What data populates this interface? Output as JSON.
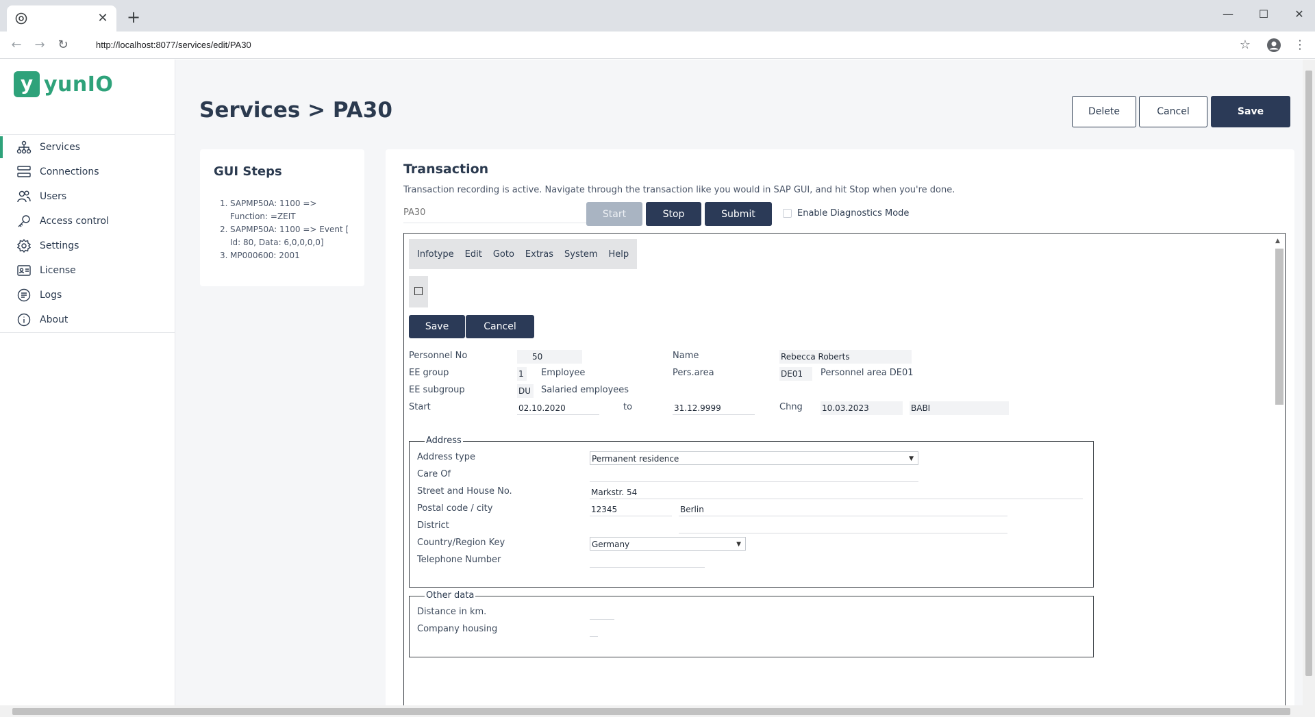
{
  "browser": {
    "url": "http://localhost:8077/services/edit/PA30",
    "tab_close": "✕",
    "new_tab": "+"
  },
  "logo": {
    "mark": "y",
    "text": "yunIO"
  },
  "sidebar": {
    "items": [
      {
        "label": "Services",
        "icon": "sitemap-icon",
        "active": true
      },
      {
        "label": "Connections",
        "icon": "connections-icon",
        "active": false
      },
      {
        "label": "Users",
        "icon": "users-icon",
        "active": false
      },
      {
        "label": "Access control",
        "icon": "key-icon",
        "active": false
      },
      {
        "label": "Settings",
        "icon": "gear-icon",
        "active": false
      },
      {
        "label": "License",
        "icon": "license-icon",
        "active": false
      },
      {
        "label": "Logs",
        "icon": "logs-icon",
        "active": false
      },
      {
        "label": "About",
        "icon": "info-icon",
        "active": false
      }
    ]
  },
  "header": {
    "title": "Services > PA30",
    "delete_label": "Delete",
    "cancel_label": "Cancel",
    "save_label": "Save"
  },
  "gui_steps": {
    "title": "GUI Steps",
    "steps": [
      {
        "num": "1.",
        "text": "SAPMP50A: 1100 => Function: =ZEIT"
      },
      {
        "num": "2.",
        "text": "SAPMP50A: 1100 => Event [ Id: 80, Data: 6,0,0,0,0]"
      },
      {
        "num": "3.",
        "text": "MP000600: 2001"
      }
    ]
  },
  "transaction": {
    "title": "Transaction",
    "description": "Transaction recording is active. Navigate through the transaction like you would in SAP GUI, and hit Stop when you're done.",
    "input_placeholder": "PA30",
    "start_label": "Start",
    "stop_label": "Stop",
    "submit_label": "Submit",
    "diagnostics_label": "Enable Diagnostics Mode"
  },
  "sap": {
    "menu": [
      "Infotype",
      "Edit",
      "Goto",
      "Extras",
      "System",
      "Help"
    ],
    "save_label": "Save",
    "cancel_label": "Cancel",
    "header": {
      "personnel_no_label": "Personnel No",
      "personnel_no": "50",
      "name_label": "Name",
      "name": "Rebecca Roberts",
      "ee_group_label": "EE group",
      "ee_group": "1",
      "ee_group_text": "Employee",
      "pers_area_label": "Pers.area",
      "pers_area": "DE01",
      "pers_area_text": "Personnel area DE01",
      "ee_subgroup_label": "EE subgroup",
      "ee_subgroup": "DU",
      "ee_subgroup_text": "Salaried employees",
      "start_label": "Start",
      "start": "02.10.2020",
      "to_label": "to",
      "to": "31.12.9999",
      "chng_label": "Chng",
      "chng": "10.03.2023",
      "chng_user": "BABI"
    },
    "address": {
      "legend": "Address",
      "address_type_label": "Address type",
      "address_type": "Permanent residence",
      "care_of_label": "Care Of",
      "care_of": "",
      "street_label": "Street and House No.",
      "street": "Markstr. 54",
      "postal_label": "Postal code / city",
      "postal_code": "12345",
      "city": "Berlin",
      "district_label": "District",
      "district": "",
      "country_label": "Country/Region Key",
      "country": "Germany",
      "telephone_label": "Telephone Number",
      "telephone": ""
    },
    "other": {
      "legend": "Other data",
      "distance_label": "Distance in km.",
      "company_housing_label": "Company housing"
    }
  },
  "colors": {
    "brand": "#2ea27a",
    "primary": "#2b3a57",
    "text": "#2b3a4f"
  }
}
